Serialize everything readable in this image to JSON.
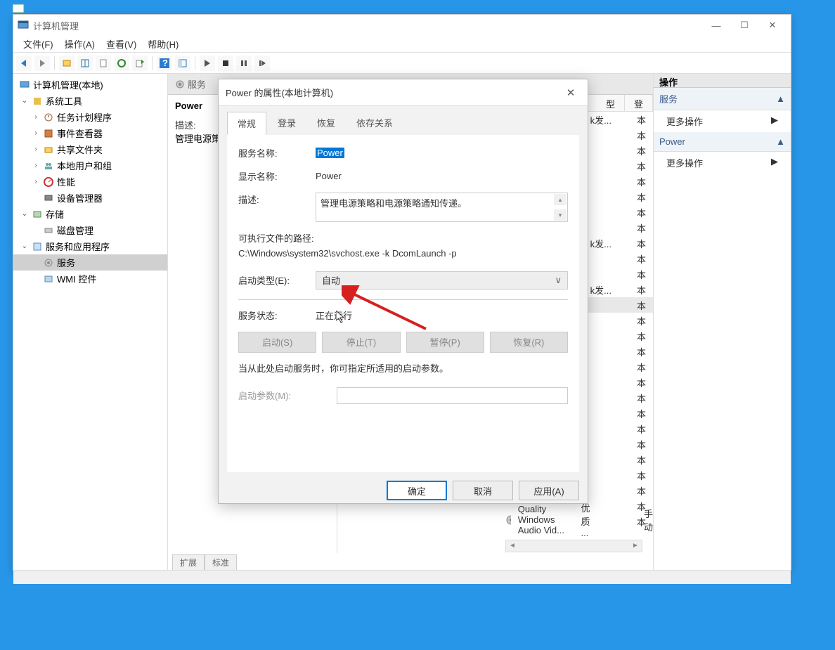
{
  "window": {
    "title": "计算机管理",
    "controls": {
      "min": "—",
      "max": "☐",
      "close": "✕"
    }
  },
  "menu": {
    "file": "文件(F)",
    "action": "操作(A)",
    "view": "查看(V)",
    "help": "帮助(H)"
  },
  "tree": {
    "root": "计算机管理(本地)",
    "system_tools": "系统工具",
    "task_scheduler": "任务计划程序",
    "event_viewer": "事件查看器",
    "shared_folders": "共享文件夹",
    "local_users": "本地用户和组",
    "performance": "性能",
    "device_manager": "设备管理器",
    "storage": "存储",
    "disk_management": "磁盘管理",
    "services_apps": "服务和应用程序",
    "services": "服务",
    "wmi": "WMI 控件"
  },
  "middle": {
    "header_tab": "服务",
    "svc_title": "Power",
    "desc_label": "描述:",
    "desc_text": "管理电源策",
    "col_type": "型",
    "col_login": "登",
    "visible_service_name": "Quality Windows Audio Vid...",
    "visible_service_desc": "优质 ...",
    "visible_service_startup": "手动",
    "bottom_tab_extended": "扩展",
    "bottom_tab_standard": "标准",
    "partial_col1": "k",
    "partial_col2": "k发...",
    "partial_col3": "k发",
    "partial_col4": "k发...",
    "partial_col5": "k",
    "partial_stub": "本"
  },
  "actions": {
    "header": "操作",
    "section_services": "服务",
    "more_actions": "更多操作",
    "section_power": "Power"
  },
  "dialog": {
    "title": "Power 的属性(本地计算机)",
    "tabs": {
      "general": "常规",
      "logon": "登录",
      "recovery": "恢复",
      "dependencies": "依存关系"
    },
    "service_name_label": "服务名称:",
    "service_name_value": "Power",
    "display_name_label": "显示名称:",
    "display_name_value": "Power",
    "description_label": "描述:",
    "description_value": "管理电源策略和电源策略通知传递。",
    "exe_path_label": "可执行文件的路径:",
    "exe_path_value": "C:\\Windows\\system32\\svchost.exe -k DcomLaunch -p",
    "startup_type_label": "启动类型(E):",
    "startup_type_value": "自动",
    "service_status_label": "服务状态:",
    "service_status_value": "正在运行",
    "btn_start": "启动(S)",
    "btn_stop": "停止(T)",
    "btn_pause": "暂停(P)",
    "btn_resume": "恢复(R)",
    "hint": "当从此处启动服务时，你可指定所适用的启动参数。",
    "start_params_label": "启动参数(M):",
    "btn_ok": "确定",
    "btn_cancel": "取消",
    "btn_apply": "应用(A)"
  }
}
